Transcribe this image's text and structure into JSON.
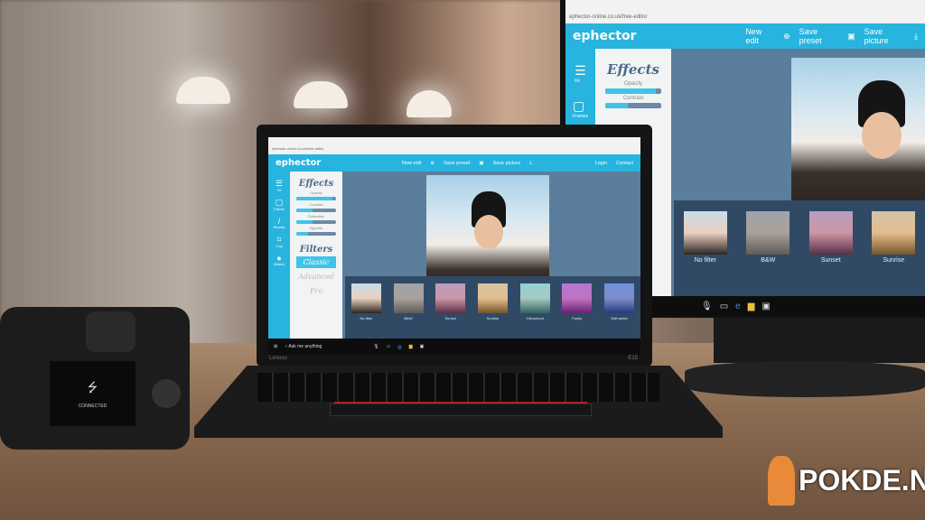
{
  "laptop": {
    "url": "ephector-online.co.uk/free-editor",
    "brand": "ephector",
    "nav": {
      "new_edit": "New edit",
      "save_preset": "Save preset",
      "save_picture": "Save picture",
      "login": "Login",
      "contact": "Contact"
    },
    "sidebar": [
      {
        "label": "Fit",
        "icon": "fit-icon"
      },
      {
        "label": "Frames",
        "icon": "frame-icon"
      },
      {
        "label": "Beautify",
        "icon": "brush-icon"
      },
      {
        "label": "Crop",
        "icon": "crop-icon"
      },
      {
        "label": "Stickers",
        "icon": "speech-bubble-icon"
      }
    ],
    "effects_title": "Effects",
    "sliders": [
      {
        "label": "Opacity",
        "value": 0.9
      },
      {
        "label": "Contrast",
        "value": 0.4
      },
      {
        "label": "Saturation",
        "value": 0.4
      },
      {
        "label": "Vignette",
        "value": 0.3
      }
    ],
    "filters_title": "Filters",
    "filter_tabs": [
      {
        "label": "Classic",
        "active": true
      },
      {
        "label": "Advanced",
        "active": false
      },
      {
        "label": "Pro",
        "active": false
      }
    ],
    "filters": [
      "No filter",
      "B&W",
      "Sunset",
      "Sunrise",
      "Old-school",
      "Funky",
      "Soft winter"
    ],
    "filter_tints": [
      "#00000000",
      "#80808099",
      "#a0408066",
      "#e0a04066",
      "#40c0c066",
      "#a020c088",
      "#2050d088"
    ],
    "taskbar_search": "Ask me anything",
    "bezel_brand": "Lenovo",
    "model": "E15"
  },
  "monitor": {
    "url": "ephector-online.co.uk/free-editor",
    "brand": "ephector",
    "nav": {
      "new_edit": "New edit",
      "save_preset": "Save preset",
      "save_picture": "Save picture"
    },
    "sidebar": [
      {
        "label": "Fit"
      },
      {
        "label": "Frames"
      }
    ],
    "effects_title": "Effects",
    "sliders": [
      {
        "label": "Opacity",
        "value": 0.9
      },
      {
        "label": "Contrast",
        "value": 0.4
      }
    ],
    "filters": [
      "No filter",
      "B&W",
      "Sunset",
      "Sunrise"
    ]
  },
  "camera": {
    "screen_text": "CONNECTED"
  },
  "watermark": "POKDE.NET",
  "colors": {
    "accent": "#27b4de",
    "canvas": "#5a7e9c",
    "strip": "#304a66"
  }
}
